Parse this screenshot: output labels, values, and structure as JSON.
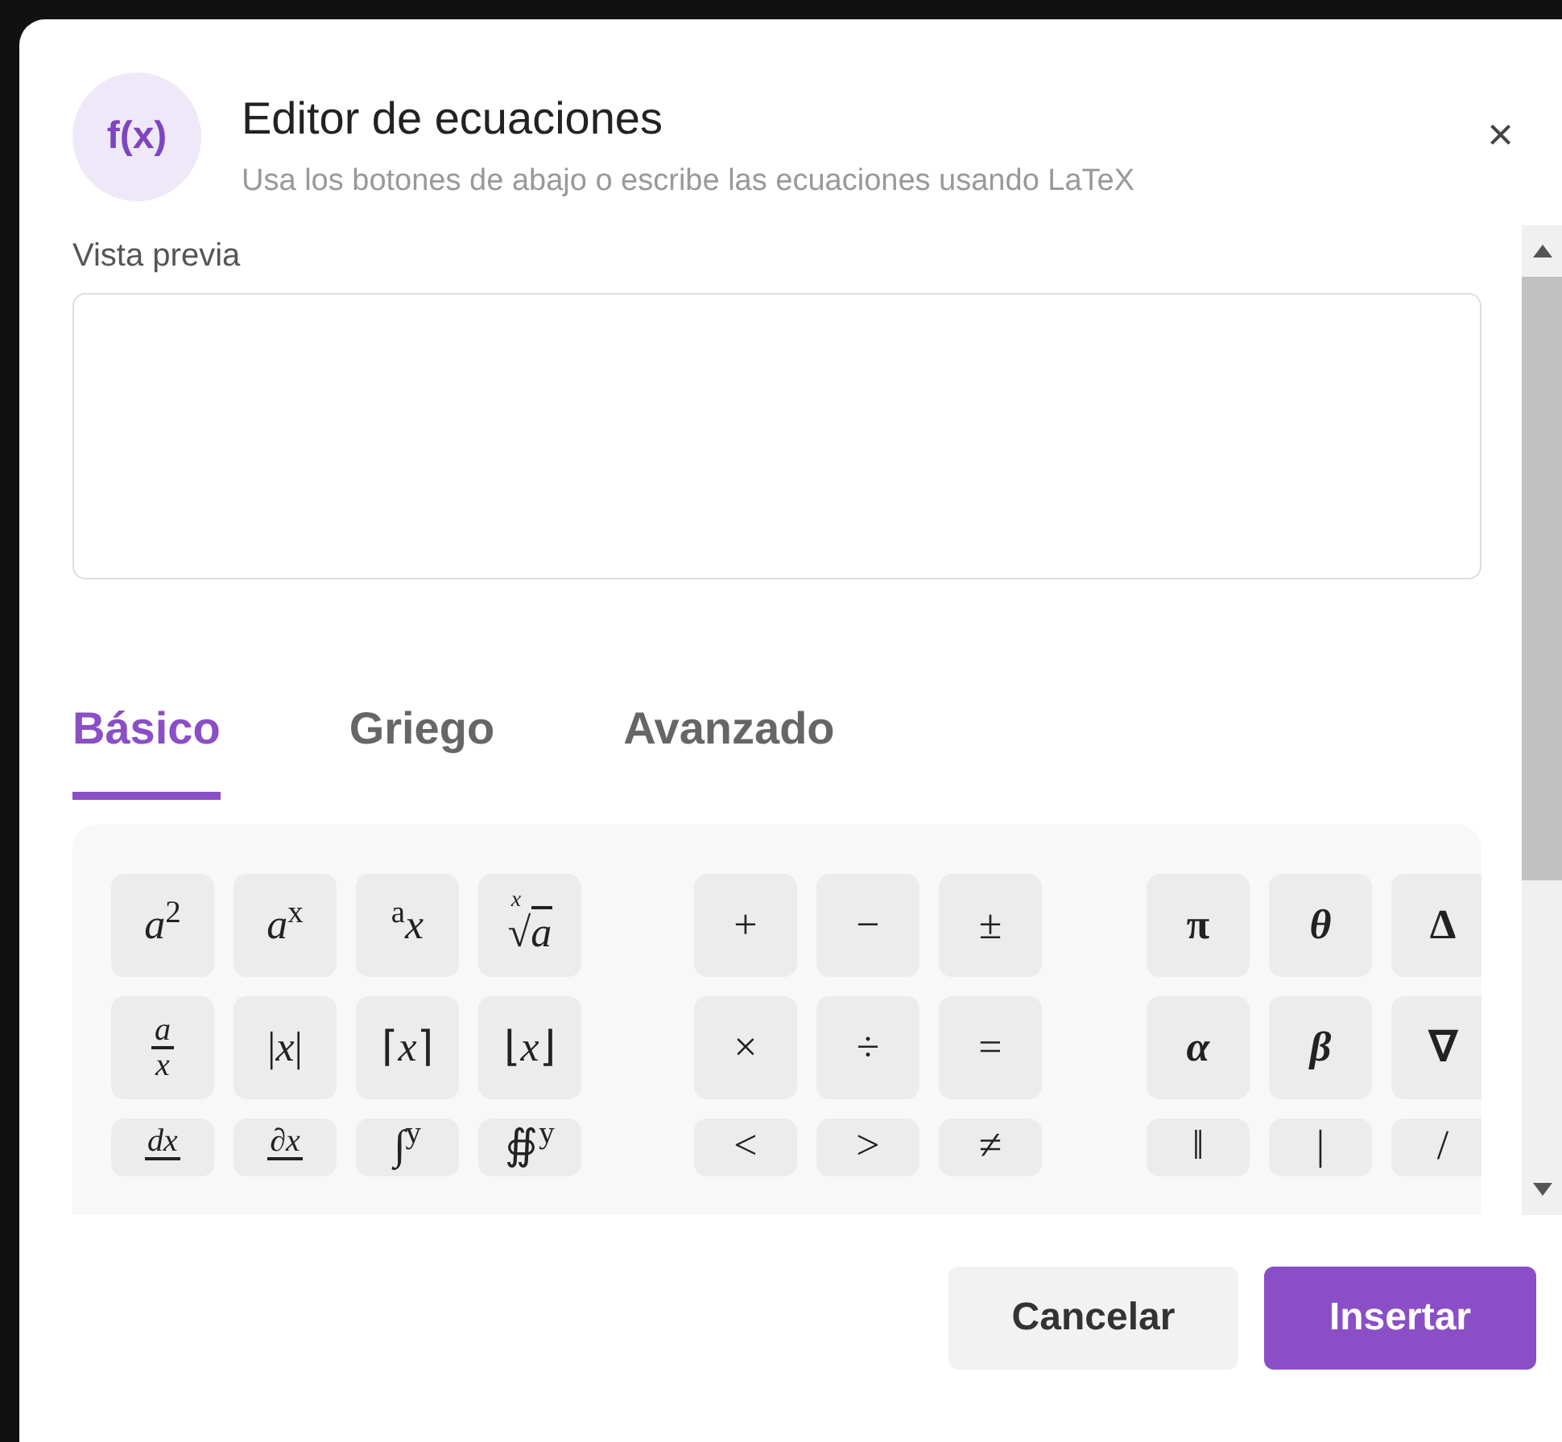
{
  "dialog": {
    "icon_text": "f(x)",
    "title": "Editor de ecuaciones",
    "subtitle": "Usa los botones de abajo o escribe las ecuaciones usando LaTeX",
    "close": "×"
  },
  "preview": {
    "label": "Vista previa"
  },
  "tabs": [
    {
      "label": "Básico",
      "selected": true
    },
    {
      "label": "Griego",
      "selected": false
    },
    {
      "label": "Avanzado",
      "selected": false
    }
  ],
  "symbol_groups": [
    {
      "rows": [
        [
          {
            "kind": "text",
            "label": "*a*$^{2}$"
          },
          {
            "kind": "text",
            "label": "*a*$^{x}$"
          },
          {
            "kind": "text",
            "label": "$^{a}$*x*"
          },
          {
            "kind": "root",
            "index": "x",
            "radical": "√",
            "radicand": "a"
          }
        ],
        [
          {
            "kind": "fraction",
            "numerator": "a",
            "denominator": "x"
          },
          {
            "kind": "text",
            "label": "|*x*|"
          },
          {
            "kind": "text",
            "label": "⌈*x*⌉"
          },
          {
            "kind": "text",
            "label": "⌊*x*⌋"
          }
        ],
        [
          {
            "kind": "fraction",
            "numerator": "dx"
          },
          {
            "kind": "fraction",
            "numerator": "∂x"
          },
          {
            "kind": "text",
            "label": "∫$^{y}$"
          },
          {
            "kind": "text",
            "label": "∯$^{y}$"
          }
        ]
      ]
    },
    {
      "rows": [
        [
          {
            "kind": "text",
            "label": "+"
          },
          {
            "kind": "text",
            "label": "−"
          },
          {
            "kind": "text",
            "label": "±"
          }
        ],
        [
          {
            "kind": "text",
            "label": "×"
          },
          {
            "kind": "text",
            "label": "÷"
          },
          {
            "kind": "text",
            "label": "="
          }
        ],
        [
          {
            "kind": "text",
            "label": "<"
          },
          {
            "kind": "text",
            "label": ">"
          },
          {
            "kind": "text",
            "label": "≠"
          }
        ]
      ]
    },
    {
      "rows": [
        [
          {
            "kind": "bold",
            "label": "π"
          },
          {
            "kind": "bold-italic",
            "label": "θ"
          },
          {
            "kind": "bold",
            "label": "Δ"
          }
        ],
        [
          {
            "kind": "bold-italic",
            "label": "α"
          },
          {
            "kind": "bold-italic",
            "label": "β"
          },
          {
            "kind": "bold",
            "label": "∇"
          }
        ],
        [
          {
            "kind": "text",
            "label": "‖"
          },
          {
            "kind": "text",
            "label": "|"
          },
          {
            "kind": "text",
            "label": "/"
          }
        ]
      ]
    }
  ],
  "buttons": [
    {
      "label": "Cancelar",
      "kind": "secondary"
    },
    {
      "label": "Insertar",
      "kind": "primary"
    }
  ]
}
